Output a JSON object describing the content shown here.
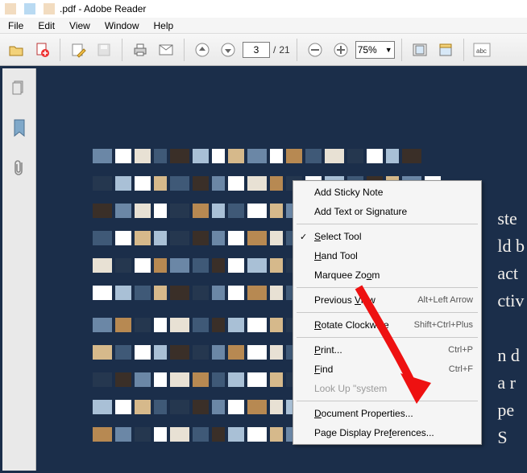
{
  "titlebar": {
    "swatch_colors": [
      "#f2dcc0",
      "#b9daf2",
      "#f2dcc0"
    ],
    "filename_suffix": ".pdf",
    "app_name": "Adobe Reader"
  },
  "menubar": {
    "items": [
      "File",
      "Edit",
      "View",
      "Window",
      "Help"
    ]
  },
  "toolbar": {
    "page_current": "3",
    "page_sep": "/",
    "page_total": "21",
    "zoom_value": "75%"
  },
  "context_menu": {
    "items": [
      {
        "label": "Add Sticky Note",
        "shortcut": "",
        "checked": false,
        "enabled": true
      },
      {
        "label": "Add Text or Signature",
        "shortcut": "",
        "checked": false,
        "enabled": true
      },
      {
        "sep": true
      },
      {
        "label": "Select Tool",
        "shortcut": "",
        "checked": true,
        "enabled": true,
        "u": 0
      },
      {
        "label": "Hand Tool",
        "shortcut": "",
        "checked": false,
        "enabled": true,
        "u": 0
      },
      {
        "label": "Marquee Zoom",
        "shortcut": "",
        "checked": false,
        "enabled": true,
        "u": 10
      },
      {
        "sep": true
      },
      {
        "label": "Previous View",
        "shortcut": "Alt+Left Arrow",
        "checked": false,
        "enabled": true,
        "u": 9
      },
      {
        "sep": true
      },
      {
        "label": "Rotate Clockwise",
        "shortcut": "Shift+Ctrl+Plus",
        "checked": false,
        "enabled": true,
        "u": 0
      },
      {
        "sep": true
      },
      {
        "label": "Print...",
        "shortcut": "Ctrl+P",
        "checked": false,
        "enabled": true,
        "u": 0
      },
      {
        "label": "Find",
        "shortcut": "Ctrl+F",
        "checked": false,
        "enabled": true,
        "u": 0
      },
      {
        "label": "Look Up \"system",
        "shortcut": "",
        "checked": false,
        "enabled": false
      },
      {
        "sep": true
      },
      {
        "label": "Document Properties...",
        "shortcut": "",
        "checked": false,
        "enabled": true,
        "u": 0
      },
      {
        "label": "Page Display Preferences...",
        "shortcut": "",
        "checked": false,
        "enabled": true,
        "u": 16
      }
    ]
  },
  "peek_text": "ste\nld b\nact\nctiv\n\nn d\na r\npe\nS"
}
